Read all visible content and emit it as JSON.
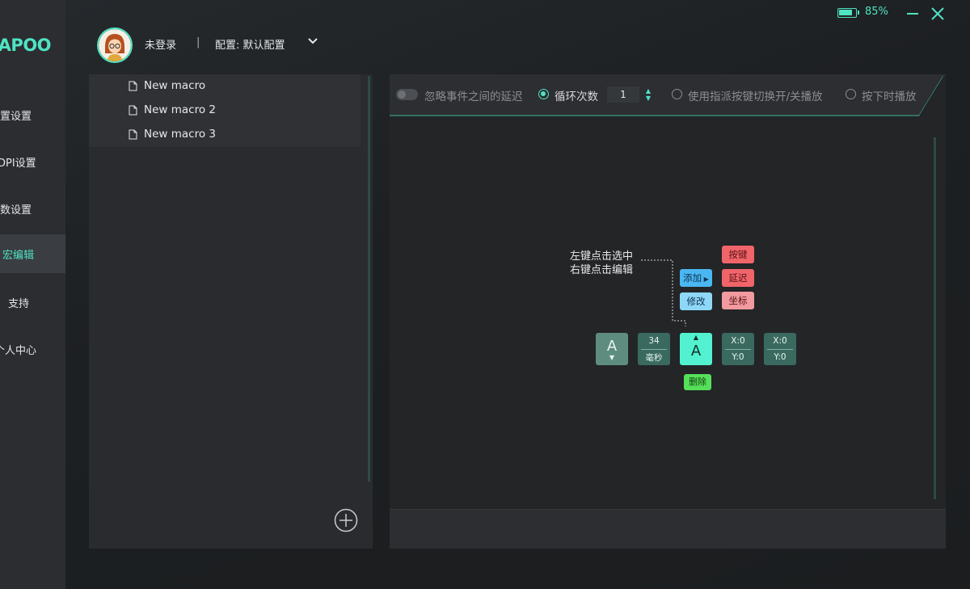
{
  "app": {
    "logo": "RAPOO",
    "battery_percent": "85%",
    "battery_level": 0.85,
    "accent": "#4fe3c3"
  },
  "sidebar": {
    "items": [
      {
        "label": "配置设置",
        "active": false
      },
      {
        "label": "DPI设置",
        "active": false
      },
      {
        "label": "参数设置",
        "active": false
      },
      {
        "label": "宏编辑",
        "active": true
      },
      {
        "label": "支持",
        "active": false
      },
      {
        "label": "个人中心",
        "active": false
      }
    ]
  },
  "header": {
    "login_status": "未登录",
    "separator": "|",
    "config_label": "配置: 默认配置"
  },
  "macros": {
    "items": [
      "New macro",
      "New macro 2",
      "New macro 3"
    ]
  },
  "toolbar": {
    "ignore_delay": "忽略事件之间的延迟",
    "loop_count": "循环次数",
    "loop_value": "1",
    "toggle_mode": "使用指派按键切换开/关播放",
    "hold_mode": "按下时播放"
  },
  "help": {
    "line1": "左键点击选中",
    "line2": "右键点击编辑"
  },
  "context": {
    "add": "添加",
    "modify": "修改",
    "key": "按键",
    "delay": "延迟",
    "coord": "坐标",
    "delete": "删除"
  },
  "sequence": {
    "key1": "A",
    "delay_value": "34",
    "delay_unit": "毫秒",
    "key2": "A",
    "coord1_x": "X:0",
    "coord1_y": "Y:0",
    "coord2_x": "X:0",
    "coord2_y": "Y:0"
  }
}
